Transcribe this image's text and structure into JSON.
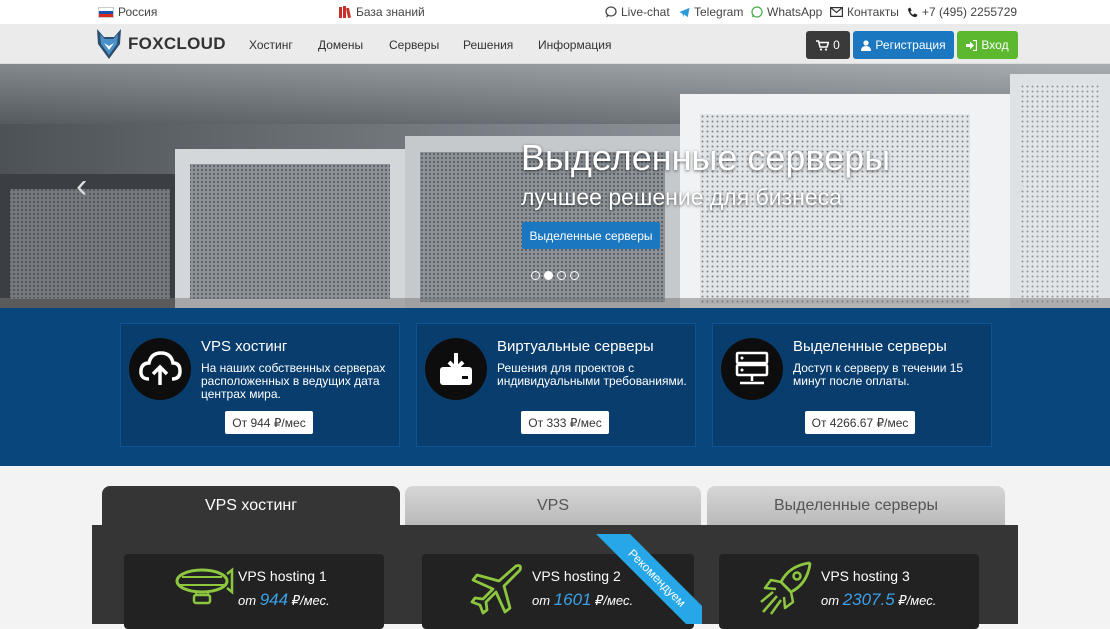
{
  "topbar": {
    "region": "Россия",
    "knowledge": "База знаний",
    "livechat": "Live-chat",
    "telegram": "Telegram",
    "whatsapp": "WhatsApp",
    "contacts": "Контакты",
    "phone": "+7 (495) 2255729"
  },
  "brand": {
    "name": "FOXCLOUD"
  },
  "nav": {
    "items": [
      "Хостинг",
      "Домены",
      "Серверы",
      "Решения",
      "Информация"
    ],
    "cart_count": "0",
    "register": "Регистрация",
    "login": "Вход"
  },
  "hero": {
    "title": "Выделенные серверы",
    "subtitle": "лучшее решение для бизнеса",
    "button": "Выделенные серверы",
    "active_slide": 2,
    "slide_count": 4
  },
  "services": [
    {
      "title": "VPS хостинг",
      "desc": "На наших собственных серверах расположенных в ведущих дата центрах мира.",
      "price": "От 944 ₽/мес",
      "icon": "cloud-upload-icon"
    },
    {
      "title": "Виртуальные серверы",
      "desc": "Решения для проектов с индивидуальными требованиями.",
      "price": "От 333 ₽/мес",
      "icon": "download-drive-icon"
    },
    {
      "title": "Выделенные серверы",
      "desc": "Доступ к серверу в течении 15 минут после оплаты.",
      "price": "От 4266.67 ₽/мес",
      "icon": "server-rack-icon"
    }
  ],
  "tabs": [
    "VPS хостинг",
    "VPS",
    "Выделенные серверы"
  ],
  "plans": [
    {
      "name": "VPS hosting 1",
      "prefix": "от",
      "price": "944",
      "unit": "₽/мес.",
      "icon": "airship-icon"
    },
    {
      "name": "VPS hosting 2",
      "prefix": "от",
      "price": "1601",
      "unit": "₽/мес.",
      "icon": "airplane-icon"
    },
    {
      "name": "VPS hosting 3",
      "prefix": "от",
      "price": "2307.5",
      "unit": "₽/мес.",
      "icon": "rocket-icon"
    }
  ],
  "ribbon": "Рекомендуем",
  "colors": {
    "accent_blue": "#1a77c0",
    "login_green": "#5cb82f",
    "services_bg": "#09467c",
    "icon_green": "#8dc63f",
    "price_blue": "#3ba0e8"
  }
}
